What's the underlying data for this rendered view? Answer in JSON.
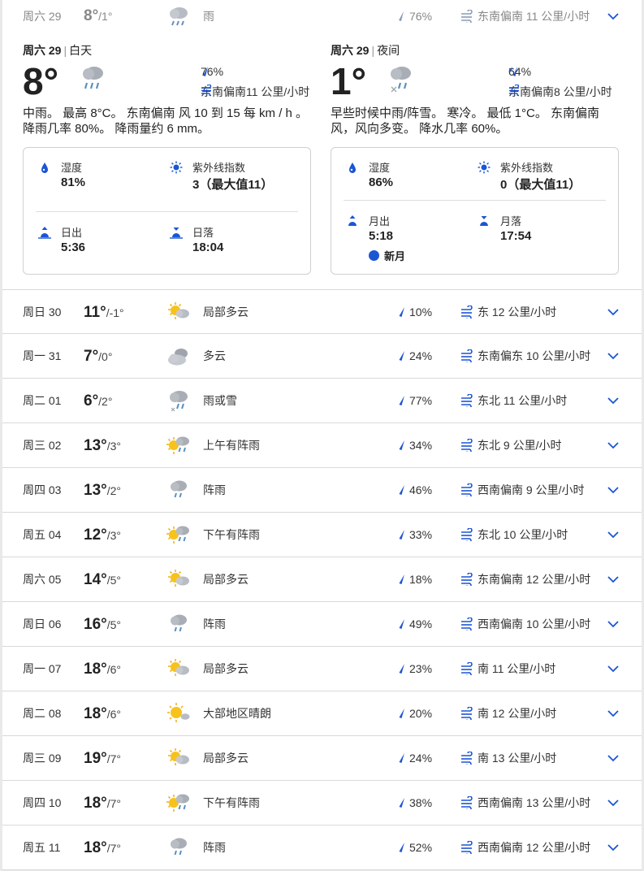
{
  "top_row": {
    "day": "周六 29",
    "hi": "8°",
    "lo": "/1°",
    "cond": "雨",
    "rain": "76%",
    "wind": "东南偏南 11 公里/小时",
    "icon": "rain-icon"
  },
  "day_panel": {
    "date": "周六 29",
    "period": "白天",
    "temp": "8°",
    "rain": "76%",
    "wind": "东南偏南11 公里/小时",
    "desc": "中雨。 最高 8°C。 东南偏南 风 10 到 15 每 km / h 。 降雨几率 80%。 降雨量约 6 mm。",
    "humidity_label": "湿度",
    "humidity": "81%",
    "uv_label": "紫外线指数",
    "uv": "3（最大值11）",
    "rise_label": "日出",
    "rise": "5:36",
    "set_label": "日落",
    "set": "18:04"
  },
  "night_panel": {
    "date": "周六 29",
    "period": "夜间",
    "temp": "1°",
    "rain": "64%",
    "wind": "东南偏南8 公里/小时",
    "desc": "早些时候中雨/阵雪。 寒冷。 最低 1°C。 东南偏南 风，风向多变。 降水几率 60%。",
    "humidity_label": "湿度",
    "humidity": "86%",
    "uv_label": "紫外线指数",
    "uv": "0（最大值11）",
    "rise_label": "月出",
    "rise": "5:18",
    "set_label": "月落",
    "set": "17:54",
    "moon_phase": "新月"
  },
  "days": [
    {
      "day": "周日 30",
      "hi": "11°",
      "lo": "/-1°",
      "cond": "局部多云",
      "rain": "10%",
      "wind": "东 12 公里/小时",
      "icon": "partly-cloudy-icon"
    },
    {
      "day": "周一 31",
      "hi": "7°",
      "lo": "/0°",
      "cond": "多云",
      "rain": "24%",
      "wind": "东南偏东 10 公里/小时",
      "icon": "cloudy-icon"
    },
    {
      "day": "周二 01",
      "hi": "6°",
      "lo": "/2°",
      "cond": "雨或雪",
      "rain": "77%",
      "wind": "东北 11 公里/小时",
      "icon": "rain-snow-icon"
    },
    {
      "day": "周三 02",
      "hi": "13°",
      "lo": "/3°",
      "cond": "上午有阵雨",
      "rain": "34%",
      "wind": "东北 9 公里/小时",
      "icon": "sun-shower-icon"
    },
    {
      "day": "周四 03",
      "hi": "13°",
      "lo": "/2°",
      "cond": "阵雨",
      "rain": "46%",
      "wind": "西南偏南 9 公里/小时",
      "icon": "shower-icon"
    },
    {
      "day": "周五 04",
      "hi": "12°",
      "lo": "/3°",
      "cond": "下午有阵雨",
      "rain": "33%",
      "wind": "东北 10 公里/小时",
      "icon": "sun-shower-icon"
    },
    {
      "day": "周六 05",
      "hi": "14°",
      "lo": "/5°",
      "cond": "局部多云",
      "rain": "18%",
      "wind": "东南偏南 12 公里/小时",
      "icon": "partly-cloudy-icon"
    },
    {
      "day": "周日 06",
      "hi": "16°",
      "lo": "/5°",
      "cond": "阵雨",
      "rain": "49%",
      "wind": "西南偏南 10 公里/小时",
      "icon": "shower-icon"
    },
    {
      "day": "周一 07",
      "hi": "18°",
      "lo": "/6°",
      "cond": "局部多云",
      "rain": "23%",
      "wind": "南 11 公里/小时",
      "icon": "partly-cloudy-icon"
    },
    {
      "day": "周二 08",
      "hi": "18°",
      "lo": "/6°",
      "cond": "大部地区晴朗",
      "rain": "20%",
      "wind": "南 12 公里/小时",
      "icon": "mostly-sunny-icon"
    },
    {
      "day": "周三 09",
      "hi": "19°",
      "lo": "/7°",
      "cond": "局部多云",
      "rain": "24%",
      "wind": "南 13 公里/小时",
      "icon": "partly-cloudy-icon"
    },
    {
      "day": "周四 10",
      "hi": "18°",
      "lo": "/7°",
      "cond": "下午有阵雨",
      "rain": "38%",
      "wind": "西南偏南 13 公里/小时",
      "icon": "sun-shower-icon"
    },
    {
      "day": "周五 11",
      "hi": "18°",
      "lo": "/7°",
      "cond": "阵雨",
      "rain": "52%",
      "wind": "西南偏南 12 公里/小时",
      "icon": "shower-icon"
    }
  ]
}
